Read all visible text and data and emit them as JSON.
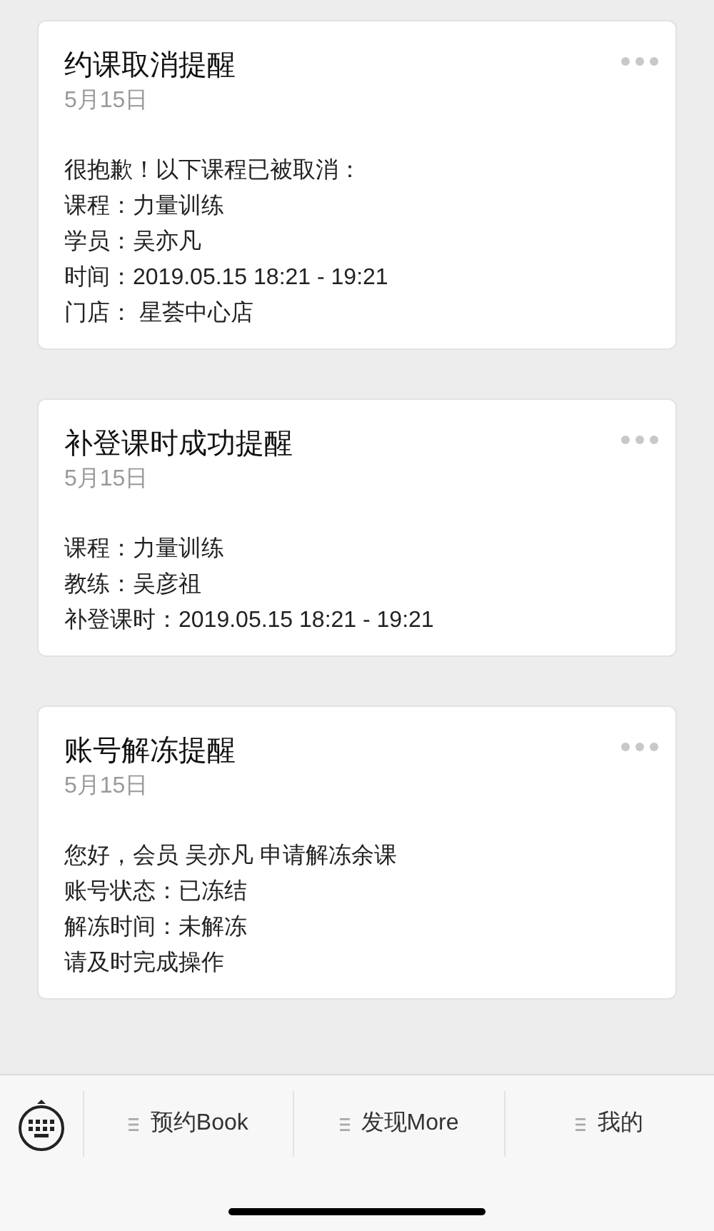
{
  "messages": [
    {
      "title": "约课取消提醒",
      "date": "5月15日",
      "lines": [
        "很抱歉！以下课程已被取消：",
        "课程：力量训练",
        "学员：吴亦凡",
        "时间：2019.05.15 18:21 - 19:21",
        "门店： 星荟中心店"
      ]
    },
    {
      "title": "补登课时成功提醒",
      "date": "5月15日",
      "lines": [
        "课程：力量训练",
        "教练：吴彦祖",
        "补登课时：2019.05.15 18:21 - 19:21"
      ]
    },
    {
      "title": "账号解冻提醒",
      "date": "5月15日",
      "lines": [
        "您好，会员 吴亦凡 申请解冻余课",
        "账号状态：已冻结",
        "解冻时间：未解冻",
        "请及时完成操作"
      ]
    }
  ],
  "menu": [
    "预约Book",
    "发现More",
    "我的"
  ]
}
